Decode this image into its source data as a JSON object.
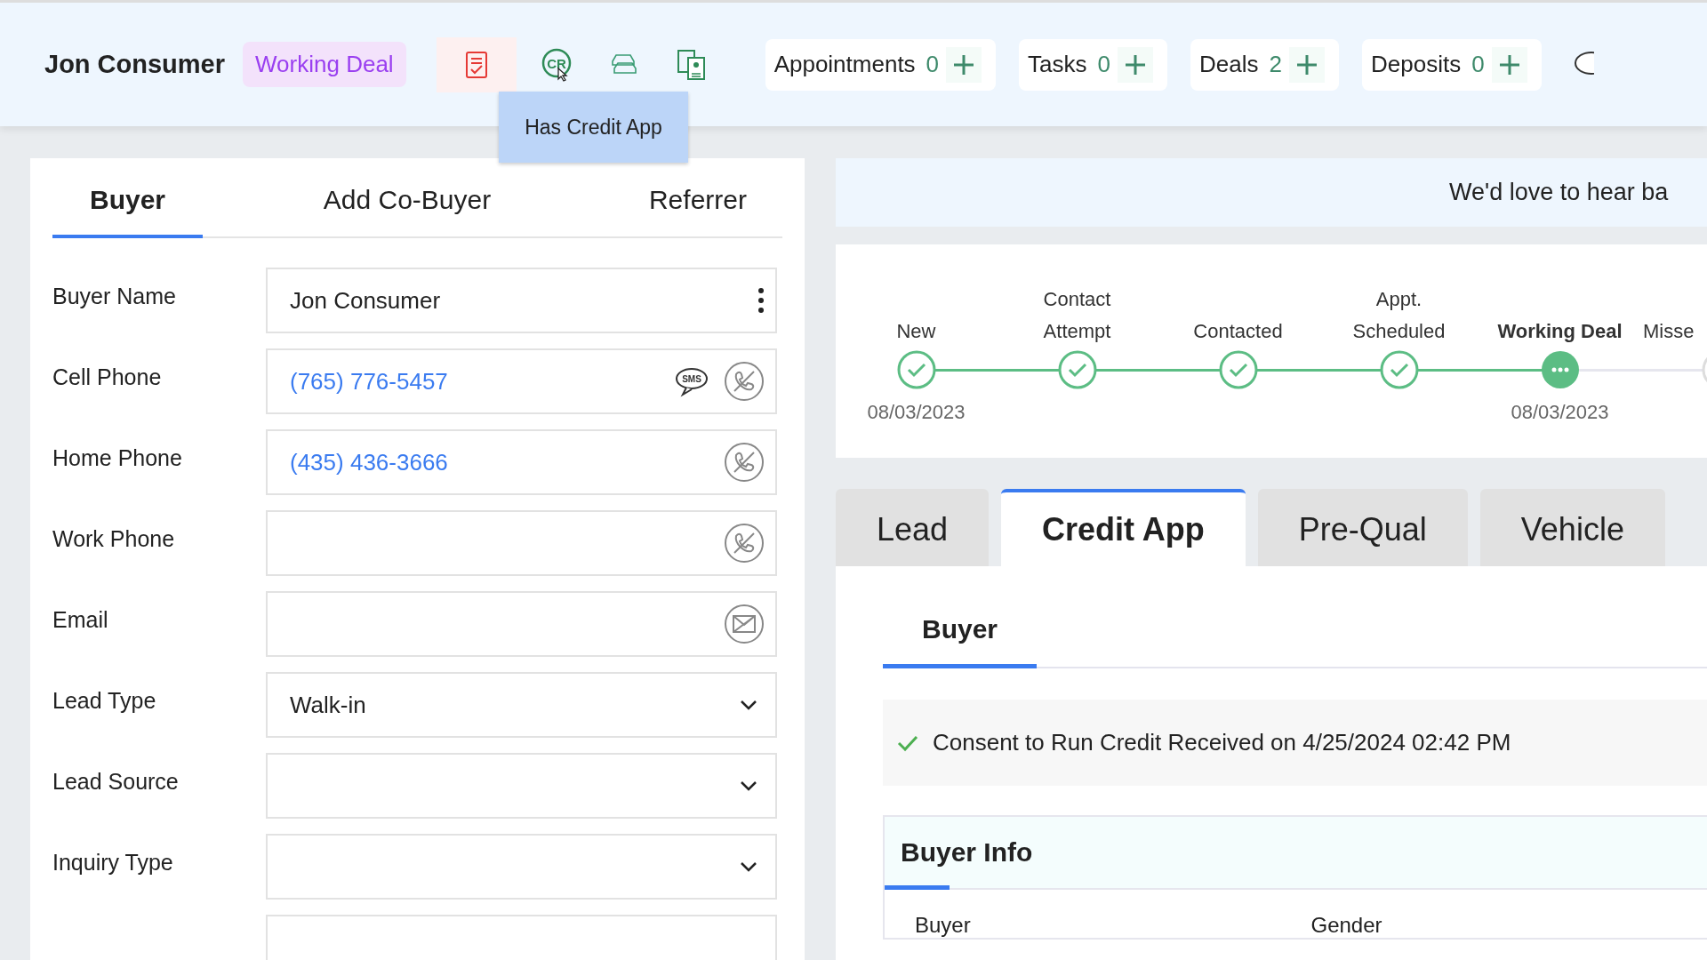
{
  "header": {
    "name": "Jon Consumer",
    "status_badge": "Working Deal",
    "icons": [
      {
        "kind": "checklist",
        "selected": true
      },
      {
        "kind": "credit",
        "label": "CR",
        "selected": false
      },
      {
        "kind": "cars",
        "selected": false
      },
      {
        "kind": "documents",
        "selected": false
      }
    ],
    "tooltip": "Has Credit App",
    "counters": [
      {
        "label": "Appointments",
        "count": "0"
      },
      {
        "label": "Tasks",
        "count": "0"
      },
      {
        "label": "Deals",
        "count": "2"
      },
      {
        "label": "Deposits",
        "count": "0"
      }
    ]
  },
  "buyer_panel": {
    "tabs": [
      {
        "label": "Buyer",
        "selected": true
      },
      {
        "label": "Add Co-Buyer",
        "selected": false
      },
      {
        "label": "Referrer",
        "selected": false
      }
    ],
    "fields": [
      {
        "label": "Buyer Name",
        "kind": "text",
        "value": "Jon Consumer"
      },
      {
        "label": "Cell Phone",
        "kind": "phone",
        "value": "(765) 776-5457",
        "sms_label": "SMS"
      },
      {
        "label": "Home Phone",
        "kind": "phone",
        "value": "(435) 436-3666"
      },
      {
        "label": "Work Phone",
        "kind": "phone"
      },
      {
        "label": "Email",
        "kind": "email"
      },
      {
        "label": "Lead Type",
        "kind": "select",
        "value": "Walk-in"
      },
      {
        "label": "Lead Source",
        "kind": "select"
      },
      {
        "label": "Inquiry Type",
        "kind": "select"
      },
      {
        "kind": "cut"
      }
    ]
  },
  "banner": "We'd love to hear ba",
  "stages": [
    {
      "label": "New",
      "kind": "done",
      "date": "08/03/2023"
    },
    {
      "label": "Contact Attempt",
      "kind": "done"
    },
    {
      "label": "Contacted",
      "kind": "done"
    },
    {
      "label": "Appt. Scheduled",
      "kind": "done"
    },
    {
      "label": "Working Deal",
      "kind": "current",
      "date": "08/03/2023"
    },
    {
      "label": "Misse",
      "kind": "pending"
    }
  ],
  "tabs": [
    {
      "label": "Lead",
      "selected": false
    },
    {
      "label": "Credit App",
      "selected": true
    },
    {
      "label": "Pre-Qual",
      "selected": false
    },
    {
      "label": "Vehicle",
      "selected": false
    }
  ],
  "credit_app": {
    "subtabs": [
      {
        "label": "Buyer",
        "selected": true
      }
    ],
    "consent": "Consent to Run Credit Received on 4/25/2024 02:42 PM",
    "section_title": "Buyer Info",
    "columns": [
      "Buyer",
      "Gender"
    ]
  }
}
